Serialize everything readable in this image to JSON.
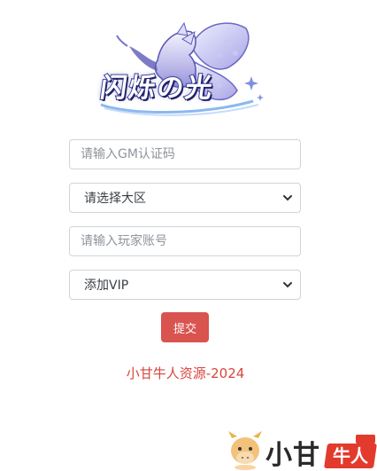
{
  "logo": {
    "text": "闪烁の光"
  },
  "form": {
    "gm_code": {
      "placeholder": "请输入GM认证码"
    },
    "region": {
      "selected": "请选择大区"
    },
    "account": {
      "placeholder": "请输入玩家账号"
    },
    "action": {
      "selected": "添加VIP"
    },
    "submit_label": "提交"
  },
  "footer": {
    "copyright": "小甘牛人资源-2024"
  },
  "watermark": {
    "text": "小甘",
    "badge": "牛人"
  },
  "colors": {
    "submit": "#d9534f",
    "copyright": "#d8453b",
    "border": "#cfd4d9",
    "logo_purple": "#8e86d8"
  }
}
